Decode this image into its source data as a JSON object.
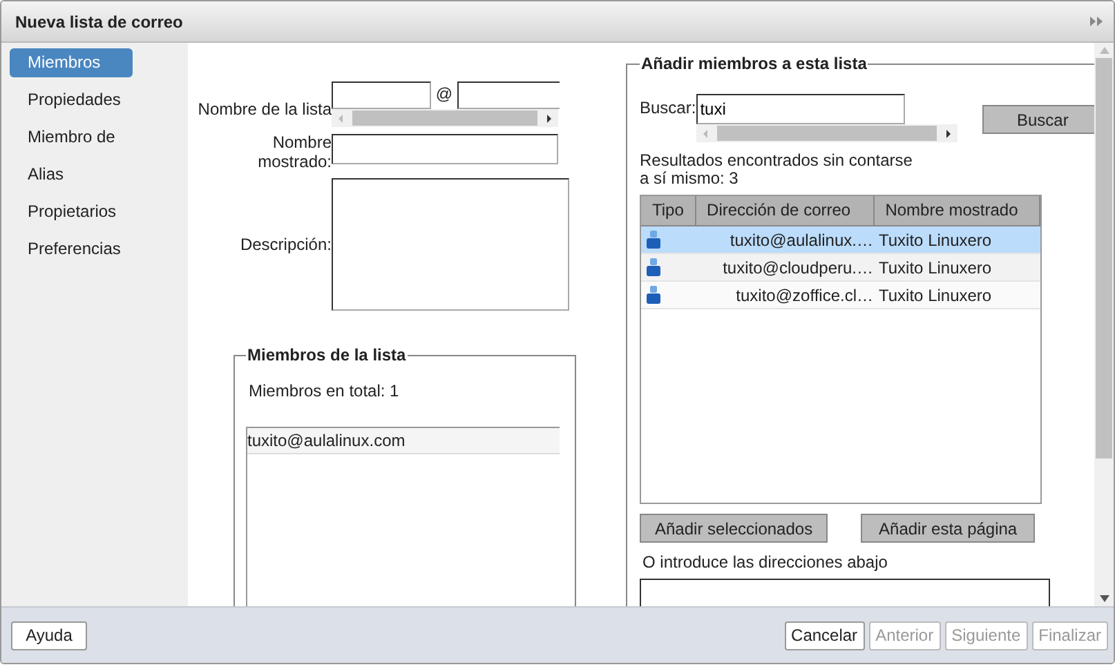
{
  "window": {
    "title": "Nueva lista de correo"
  },
  "sidebar": {
    "items": [
      {
        "label": "Miembros",
        "selected": true
      },
      {
        "label": "Propiedades",
        "selected": false
      },
      {
        "label": "Miembro de",
        "selected": false
      },
      {
        "label": "Alias",
        "selected": false
      },
      {
        "label": "Propietarios",
        "selected": false
      },
      {
        "label": "Preferencias",
        "selected": false
      }
    ]
  },
  "form": {
    "list_name_label": "Nombre de la lista",
    "at_sign": "@",
    "display_name_label": "Nombre mostrado:",
    "description_label": "Descripción:"
  },
  "list_members": {
    "title": "Miembros de la lista",
    "total": "Miembros en total: 1",
    "members": [
      "tuxito@aulalinux.com"
    ]
  },
  "add_members": {
    "title": "Añadir miembros a esta lista",
    "search_label": "Buscar:",
    "search_value": "tuxi",
    "search_button": "Buscar",
    "results_text": "Resultados encontrados sin contarse a sí mismo: 3",
    "table": {
      "columns": [
        "Tipo",
        "Dirección de correo",
        "Nombre mostrado"
      ],
      "rows": [
        {
          "address": "tuxito@aulalinux.…",
          "name": "Tuxito Linuxero",
          "selected": true
        },
        {
          "address": "tuxito@cloudperu.…",
          "name": "Tuxito Linuxero",
          "selected": false
        },
        {
          "address": "tuxito@zoffice.cl…",
          "name": "Tuxito Linuxero",
          "selected": false
        }
      ]
    },
    "buttons": [
      "Añadir seleccionados",
      "Añadir esta página"
    ],
    "addresses_label": "O introduce las direcciones abajo"
  },
  "footer": {
    "help_button": "Ayuda",
    "buttons": [
      {
        "label": "Cancelar",
        "disabled": false
      },
      {
        "label": "Anterior",
        "disabled": true
      },
      {
        "label": "Siguiente",
        "disabled": true
      },
      {
        "label": "Finalizar",
        "disabled": true
      }
    ]
  }
}
